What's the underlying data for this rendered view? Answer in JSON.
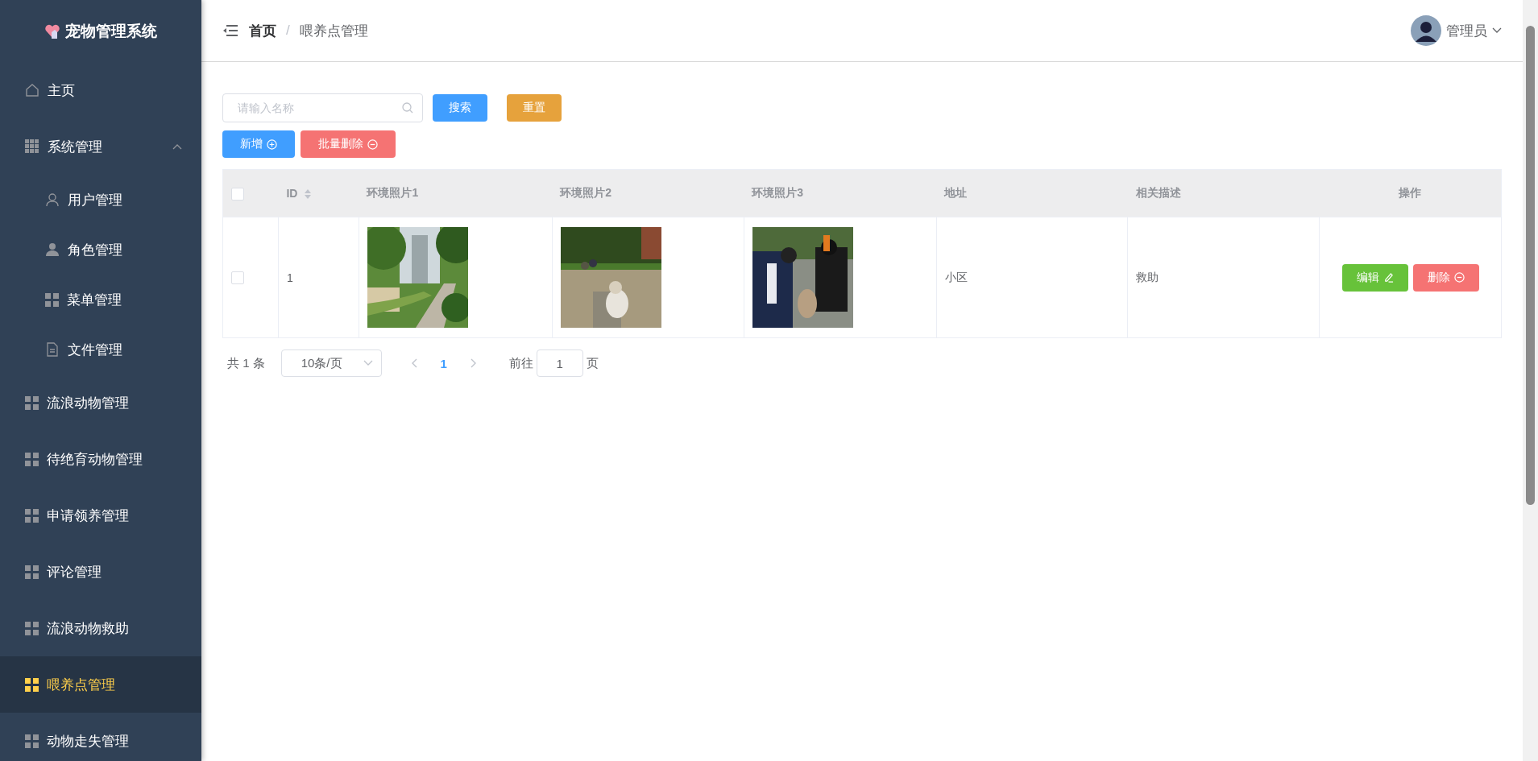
{
  "sidebar": {
    "brand": "宠物管理系统",
    "items": [
      {
        "kind": "home",
        "label": "主页",
        "selected": false
      },
      {
        "kind": "group",
        "label": "系统管理",
        "selected": false,
        "expanded": true,
        "children": [
          {
            "kind": "user",
            "label": "用户管理",
            "selected": false
          },
          {
            "kind": "role",
            "label": "角色管理",
            "selected": false
          },
          {
            "kind": "grid",
            "label": "菜单管理",
            "selected": false
          },
          {
            "kind": "file",
            "label": "文件管理",
            "selected": false
          }
        ]
      },
      {
        "kind": "grid",
        "label": "流浪动物管理",
        "selected": false
      },
      {
        "kind": "grid",
        "label": "待绝育动物管理",
        "selected": false
      },
      {
        "kind": "grid",
        "label": "申请领养管理",
        "selected": false
      },
      {
        "kind": "grid",
        "label": "评论管理",
        "selected": false
      },
      {
        "kind": "grid",
        "label": "流浪动物救助",
        "selected": false
      },
      {
        "kind": "grid",
        "label": "喂养点管理",
        "selected": true
      },
      {
        "kind": "grid",
        "label": "动物走失管理",
        "selected": false
      }
    ]
  },
  "header": {
    "breadcrumb": [
      "首页",
      "喂养点管理"
    ],
    "separator": "/",
    "user": "管理员"
  },
  "toolbar": {
    "search": {
      "placeholder": "请输入名称"
    },
    "buttons": [
      {
        "kind": "search",
        "label": "搜索"
      },
      {
        "kind": "reset",
        "label": "重置"
      },
      {
        "kind": "add",
        "label": "新增"
      },
      {
        "kind": "batch-delete",
        "label": "批量删除"
      }
    ]
  },
  "table": {
    "select_all": {
      "checked": false
    },
    "columns": [
      {
        "label": "ID",
        "sortable": true
      },
      {
        "label": "环境照片1",
        "sortable": false
      },
      {
        "label": "环境照片2",
        "sortable": false
      },
      {
        "label": "环境照片3",
        "sortable": false
      },
      {
        "label": "地址",
        "sortable": false
      },
      {
        "label": "相关描述",
        "sortable": false
      },
      {
        "label": "操作",
        "sortable": false
      }
    ],
    "rows": [
      {
        "checked": false,
        "id": "1",
        "photos": [
          {
            "kind": "picture"
          },
          {
            "kind": "picture"
          },
          {
            "kind": "picture"
          }
        ],
        "address": "小区",
        "description": "救助",
        "actions": [
          {
            "kind": "edit",
            "label": "编辑"
          },
          {
            "kind": "delete",
            "label": "删除"
          }
        ]
      }
    ]
  },
  "pagination": {
    "total": "共 1 条",
    "page_size": "10条/页",
    "pages": [
      {
        "label": "1",
        "selected": true
      }
    ],
    "goto_label": "前往",
    "goto_value": "1",
    "goto_suffix": "页"
  }
}
